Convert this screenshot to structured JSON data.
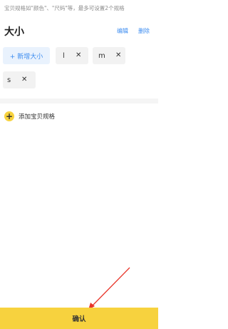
{
  "hint": "宝贝规格如\"颜色\"、\"尺码\"等，最多可设置2个规格",
  "spec": {
    "title": "大小",
    "edit_label": "编辑",
    "delete_label": "删除",
    "add_value_label": "+ 新增大小",
    "values": [
      "l",
      "m",
      "s"
    ],
    "remove_glyph": "✕"
  },
  "add_spec": {
    "plus": "+",
    "label": "添加宝贝规格"
  },
  "confirm_label": "确认",
  "colors": {
    "accent": "#f7d23e",
    "link": "#3c8cf0",
    "annotation_arrow": "#e8352a"
  }
}
